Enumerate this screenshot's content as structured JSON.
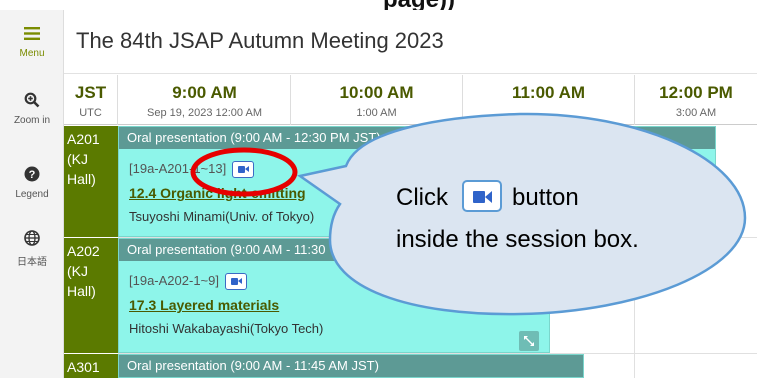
{
  "top_strip_text": "page))",
  "sidebar": {
    "items": [
      {
        "label": "Menu",
        "icon": "hamburger-menu-icon"
      },
      {
        "label": "Zoom in",
        "icon": "zoom-in-icon"
      },
      {
        "label": "Legend",
        "icon": "help-circle-icon"
      },
      {
        "label": "日本語",
        "icon": "globe-icon"
      }
    ]
  },
  "header": {
    "title": "The 84th JSAP Autumn Meeting 2023"
  },
  "timebar": {
    "tz_main": "JST",
    "tz_sub": "UTC",
    "columns": [
      {
        "main": "9:00 AM",
        "sub": "Sep 19, 2023 12:00 AM"
      },
      {
        "main": "10:00 AM",
        "sub": "1:00 AM"
      },
      {
        "main": "11:00 AM",
        "sub": ""
      },
      {
        "main": "12:00 PM",
        "sub": "3:00 AM"
      }
    ]
  },
  "rows": [
    {
      "room_lines": [
        "A201",
        "(KJ",
        "Hall)"
      ],
      "header": "Oral presentation  (9:00 AM - 12:30 PM JST)",
      "code": "[19a-A201-1~13]",
      "topic": "12.4 Organic light-emitting",
      "chair": "Tsuyoshi Minami(Univ. of Tokyo)"
    },
    {
      "room_lines": [
        "A202",
        "(KJ",
        "Hall)"
      ],
      "header": "Oral presentation  (9:00 AM - 11:30",
      "code": "[19a-A202-1~9]",
      "topic": "17.3 Layered materials",
      "chair": "Hitoshi Wakabayashi(Tokyo Tech)"
    },
    {
      "room_lines": [
        "A301"
      ],
      "header": "Oral presentation  (9:00 AM - 11:45 AM JST)"
    }
  ],
  "callout": {
    "line1_before": "Click",
    "line1_after": "button",
    "line2": "inside the session box.",
    "button_icon": "video-camera-icon",
    "bubble_color": "#dbe5f1",
    "bubble_border": "#5b9bd5",
    "highlight_color": "#e60000"
  },
  "colors": {
    "accent_green": "#5b7a00",
    "session_fill": "#8ef5ea",
    "session_header": "#5d9a95",
    "video_button": "#2f63c9"
  }
}
